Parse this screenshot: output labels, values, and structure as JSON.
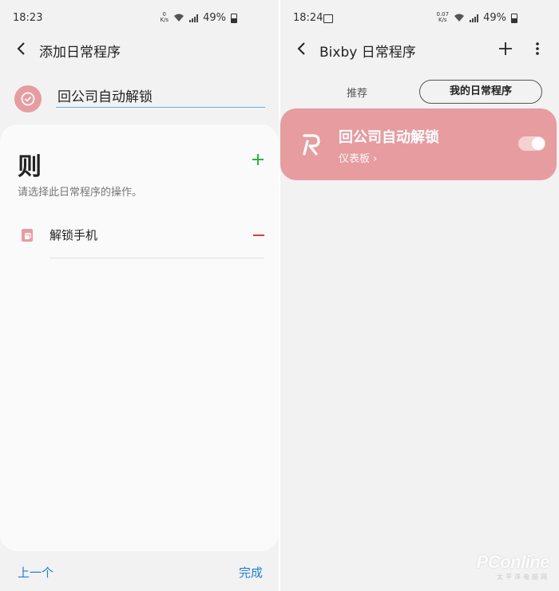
{
  "left": {
    "status": {
      "time": "18:23",
      "speed_top": "0",
      "speed_bottom": "K/s",
      "battery": "49%"
    },
    "appbar": {
      "title": "添加日常程序"
    },
    "routine_name": {
      "value": "回公司自动解锁"
    },
    "then": {
      "title": "则",
      "description": "请选择此日常程序的操作。",
      "actions": [
        {
          "label": "解锁手机",
          "icon": "lock-icon"
        }
      ]
    },
    "nav": {
      "prev": "上一个",
      "done": "完成"
    }
  },
  "right": {
    "status": {
      "time": "18:24",
      "speed_top": "0.07",
      "speed_bottom": "K/s",
      "battery": "49%"
    },
    "appbar": {
      "title": "Bixby 日常程序"
    },
    "tabs": {
      "recommended": "推荐",
      "mine": "我的日常程序"
    },
    "routines": [
      {
        "name": "回公司自动解锁",
        "subtitle": "仪表板 ›",
        "enabled": true
      }
    ]
  },
  "watermark": {
    "main": "PConline",
    "sub": "太平洋电脑网"
  },
  "colors": {
    "accent_pink": "#e79ca0",
    "add_green": "#2bb14a",
    "remove_red": "#e23b3b",
    "link_blue": "#1e7fd8"
  }
}
